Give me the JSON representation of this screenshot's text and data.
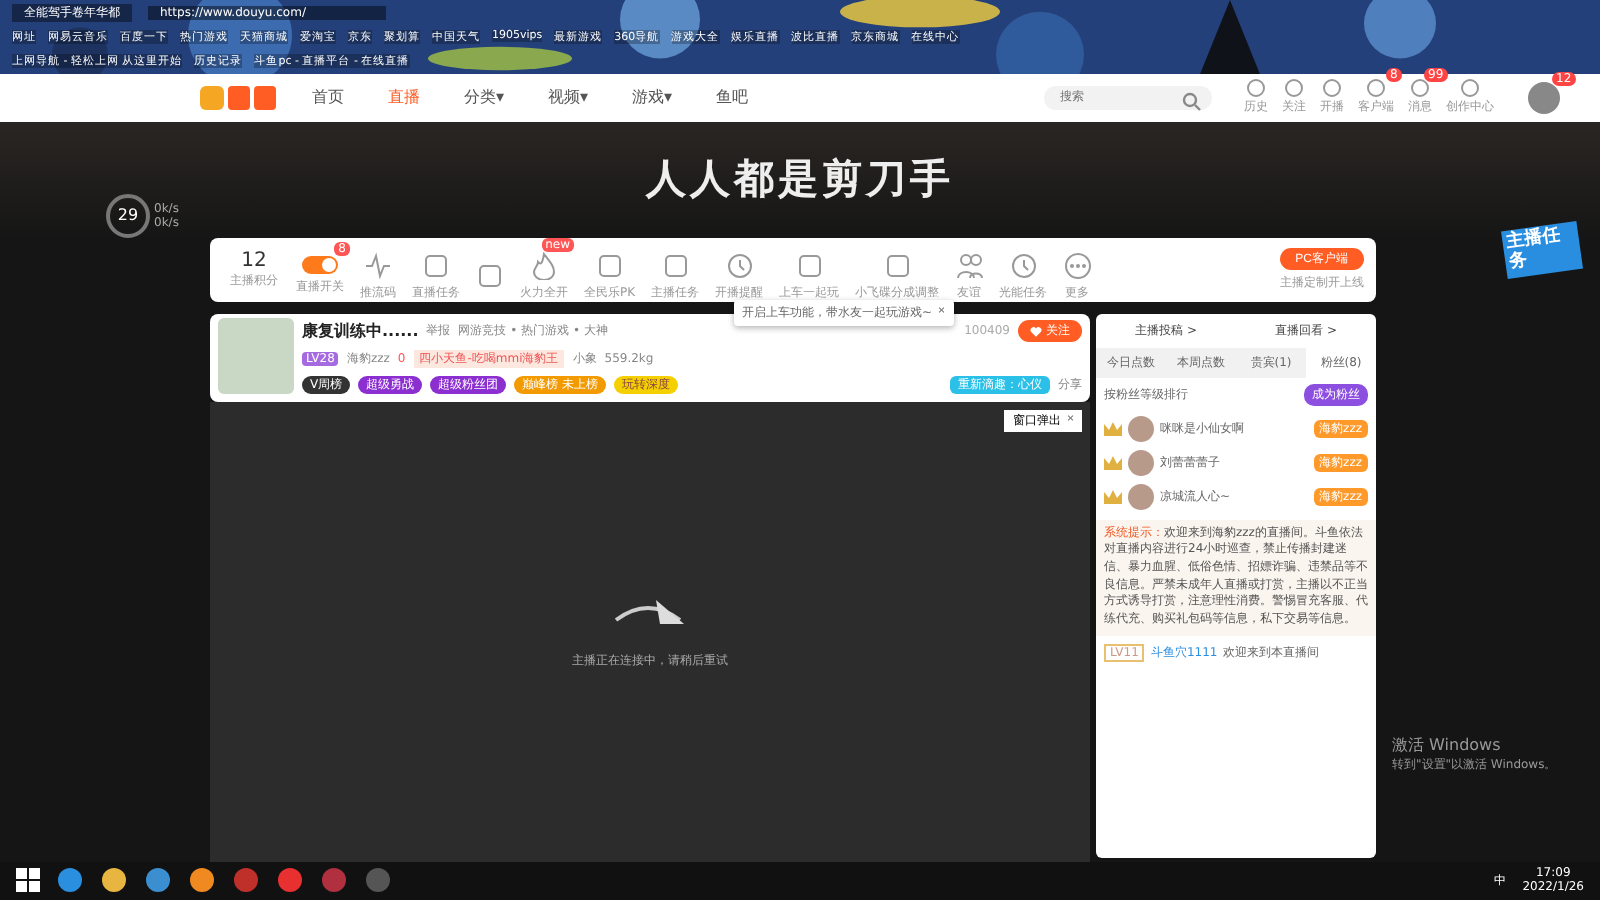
{
  "browser": {
    "tab_title": "全能驾手卷年华都",
    "address": "https://www.douyu.com/",
    "bookmarks": [
      "网址",
      "网易云音乐",
      "百度一下",
      "热门游戏",
      "天猫商城",
      "爱淘宝",
      "京东",
      "聚划算",
      "中国天气",
      "1905vips",
      "最新游戏",
      "360导航",
      "游戏大全",
      "娱乐直播",
      "波比直播",
      "京东商城",
      "在线中心"
    ],
    "quick_links": [
      "上网导航 - 轻松上网 从这里开始",
      "历史记录",
      "斗鱼pc - 直播平台 - 在线直播"
    ]
  },
  "site_header": {
    "nav": [
      {
        "label": "首页",
        "selected": false
      },
      {
        "label": "直播",
        "selected": true
      },
      {
        "label": "分类▾",
        "selected": false
      },
      {
        "label": "视频▾",
        "selected": false
      },
      {
        "label": "游戏▾",
        "selected": false
      },
      {
        "label": "鱼吧",
        "selected": false
      }
    ],
    "search": {
      "placeholder": "搜索"
    },
    "actions": [
      {
        "label": "历史"
      },
      {
        "label": "关注"
      },
      {
        "label": "开播"
      },
      {
        "label": "客户端",
        "badge": "8"
      },
      {
        "label": "消息",
        "badge": "99"
      },
      {
        "label": "创作中心"
      }
    ],
    "avatar_badge": "12"
  },
  "banner": {
    "title": "人人都是剪刀手"
  },
  "speed_widget": {
    "value": "29",
    "readings": [
      "0k/s",
      "0k/s"
    ]
  },
  "toolbar": {
    "score": "12",
    "score_label": "主播积分",
    "items": [
      {
        "label": "直播开关",
        "kind": "toggle",
        "on": true,
        "badge": "8"
      },
      {
        "label": "推流码",
        "kind": "icon"
      },
      {
        "label": "直播任务",
        "kind": "icon"
      },
      {
        "kind": "icon"
      },
      {
        "label": "火力全开",
        "kind": "icon",
        "badge": "new"
      },
      {
        "label": "全民乐PK",
        "kind": "icon"
      },
      {
        "label": "主播任务",
        "kind": "icon"
      },
      {
        "label": "开播提醒",
        "kind": "icon"
      },
      {
        "label": "上车一起玩",
        "kind": "icon"
      },
      {
        "label": "小飞碟分成调整",
        "kind": "icon"
      },
      {
        "label": "友谊",
        "kind": "icon"
      },
      {
        "label": "光能任务",
        "kind": "icon"
      },
      {
        "label": "更多",
        "kind": "icon"
      }
    ],
    "client_button": "PC客户端",
    "client_note": "主播定制开上线",
    "tooltip": "开启上车功能，带水友一起玩游戏~",
    "tooltip_close": "×"
  },
  "room": {
    "title": "康复训练中......",
    "report": "举报",
    "category": "网游竞技 • 热门游戏 • 大神",
    "level": "LV28",
    "nickname": "海豹zzz",
    "fire": "0",
    "honor": "四小天鱼-吃喝mmi海豹王",
    "host": "小象",
    "weight": "559.2kg",
    "room_id": "100409",
    "follow": "关注",
    "pills": [
      "V周榜",
      "超级勇战",
      "超级粉丝团",
      "巅峰榜 未上榜",
      "玩转深度"
    ],
    "promo": "重新滴趣：心仪",
    "share": "分享",
    "popout": "窗口弹出",
    "popout_close": "×"
  },
  "player": {
    "status": "主播正在连接中，请稍后重试"
  },
  "side_panel": {
    "links": [
      "主播投稿 >",
      "直播回看 >"
    ],
    "tabs": [
      {
        "label": "今日点数",
        "selected": false
      },
      {
        "label": "本周点数",
        "selected": false
      },
      {
        "label": "贵宾(1)",
        "selected": false
      },
      {
        "label": "粉丝(8)",
        "selected": true
      }
    ],
    "rank_title": "按粉丝等级排行",
    "join": "成为粉丝",
    "fans": [
      {
        "name": "咪咪是小仙女啊",
        "badge": "海豹zzz"
      },
      {
        "name": "刘蕾蕾蕾子",
        "badge": "海豹zzz"
      },
      {
        "name": "凉城流人心~",
        "badge": "海豹zzz"
      }
    ],
    "system_label": "系统提示：",
    "system_text": "欢迎来到海豹zzz的直播间。斗鱼依法对直播内容进行24小时巡查，禁止传播封建迷信、暴力血腥、低俗色情、招嫖诈骗、违禁品等不良信息。严禁未成年人直播或打赏，主播以不正当方式诱导打赏，注意理性消费。警惕冒充客服、代练代充、购买礼包码等信息，私下交易等信息。",
    "chat": {
      "level": "LV11",
      "user": "斗鱼穴1111",
      "text": "欢迎来到本直播间"
    }
  },
  "task_badge": "主播任务",
  "activation": [
    "激活 Windows",
    "转到\"设置\"以激活 Windows。"
  ],
  "taskbar": {
    "ime": "中",
    "time": "17:09",
    "date": "2022/1/26"
  }
}
